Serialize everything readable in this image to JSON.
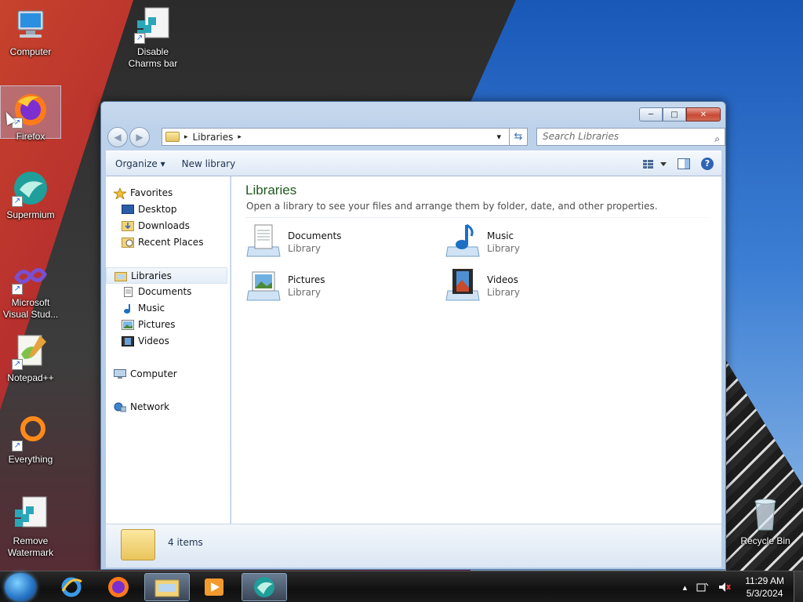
{
  "desktop": {
    "icons": [
      {
        "label_l1": "Computer",
        "label_l2": "",
        "icon": "computer-icon"
      },
      {
        "label_l1": "Disable",
        "label_l2": "Charms bar",
        "icon": "registry-script-icon"
      },
      {
        "label_l1": "Firefox",
        "label_l2": "",
        "icon": "firefox-icon"
      },
      {
        "label_l1": "Supermium",
        "label_l2": "",
        "icon": "supermium-icon"
      },
      {
        "label_l1": "Microsoft",
        "label_l2": "Visual Stud...",
        "icon": "visual-studio-icon"
      },
      {
        "label_l1": "Notepad++",
        "label_l2": "",
        "icon": "notepad-plus-plus-icon"
      },
      {
        "label_l1": "Everything",
        "label_l2": "",
        "icon": "everything-search-icon"
      },
      {
        "label_l1": "Remove",
        "label_l2": "Watermark",
        "icon": "registry-script-icon"
      },
      {
        "label_l1": "Recycle Bin",
        "label_l2": "",
        "icon": "recycle-bin-icon"
      }
    ]
  },
  "explorer": {
    "address": {
      "crumb": "Libraries",
      "sep": "▸",
      "dropdown": "▾",
      "refresh": "⇆"
    },
    "search": {
      "placeholder": "Search Libraries",
      "icon": "⌕"
    },
    "toolbar": {
      "organize": "Organize ▾",
      "new_library": "New library",
      "views_icon": "views-icon",
      "preview_icon": "preview-pane-icon",
      "help": "?"
    },
    "nav": {
      "favorites": "Favorites",
      "desktop": "Desktop",
      "downloads": "Downloads",
      "recent": "Recent Places",
      "libraries": "Libraries",
      "documents": "Documents",
      "music": "Music",
      "pictures": "Pictures",
      "videos": "Videos",
      "computer": "Computer",
      "network": "Network"
    },
    "content": {
      "title": "Libraries",
      "subtitle": "Open a library to see your files and arrange them by folder, date, and other properties.",
      "libraries": [
        {
          "name": "Documents",
          "type": "Library"
        },
        {
          "name": "Music",
          "type": "Library"
        },
        {
          "name": "Pictures",
          "type": "Library"
        },
        {
          "name": "Videos",
          "type": "Library"
        }
      ]
    },
    "status": {
      "count": "4 items"
    }
  },
  "taskbar": {
    "time": "11:29 AM",
    "date": "5/3/2024",
    "tray_chevron": "▴"
  },
  "colors": {
    "title_green": "#1e5a1e",
    "accent_blue": "#2f64b5"
  }
}
